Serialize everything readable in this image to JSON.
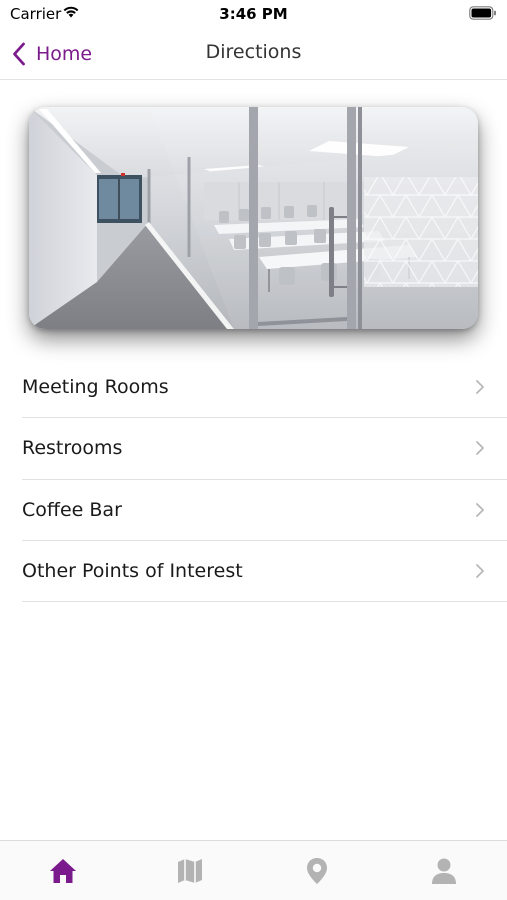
{
  "status_bar": {
    "carrier": "Carrier",
    "time": "3:46 PM",
    "icons": [
      "wifi-icon",
      "battery-icon"
    ]
  },
  "nav": {
    "back_label": "Home",
    "title": "Directions",
    "back_icon": "chevron-left-icon"
  },
  "hero_image": {
    "subject": "photo-glass-walled-conference-room-and-corridor"
  },
  "menu": {
    "items": [
      {
        "label": "Meeting Rooms"
      },
      {
        "label": "Restrooms"
      },
      {
        "label": "Coffee Bar"
      },
      {
        "label": "Other Points of Interest"
      }
    ],
    "chevron_icon": "chevron-right-icon"
  },
  "tab_bar": {
    "tabs": [
      {
        "icon": "home-icon",
        "active": true
      },
      {
        "icon": "map-icon",
        "active": false
      },
      {
        "icon": "location-pin-icon",
        "active": false
      },
      {
        "icon": "user-icon",
        "active": false
      }
    ]
  },
  "colors": {
    "accent": "#7b1a8c",
    "inactive_icon": "#b3b3b3",
    "divider": "#e2e2e2"
  }
}
